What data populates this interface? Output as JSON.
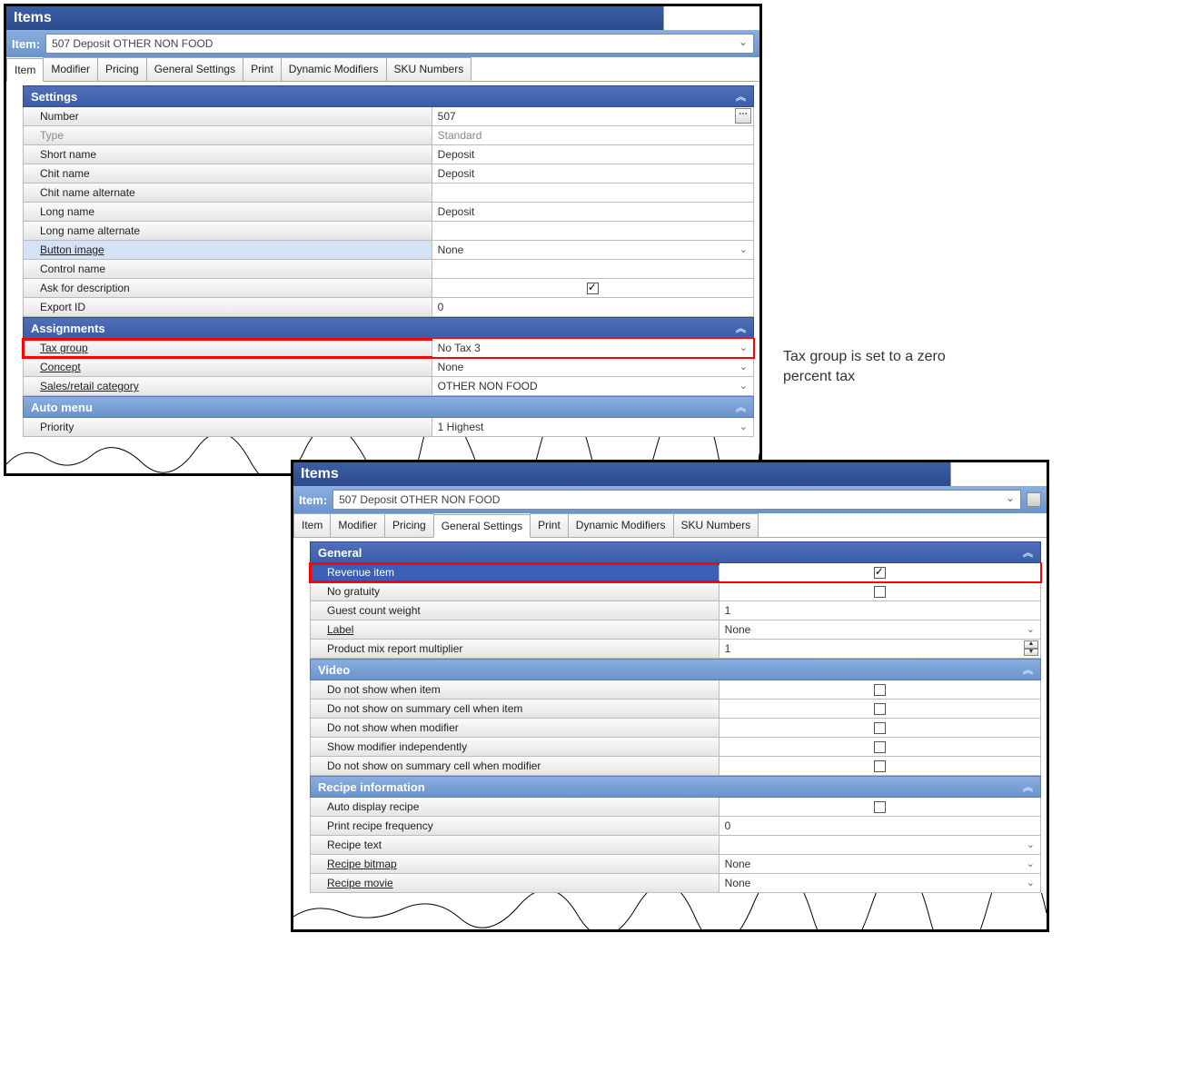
{
  "window_title": "Items",
  "item_label": "Item:",
  "item_value": "507 Deposit OTHER NON FOOD",
  "tabs": [
    "Item",
    "Modifier",
    "Pricing",
    "General Settings",
    "Print",
    "Dynamic Modifiers",
    "SKU Numbers"
  ],
  "shot1": {
    "active_tab": "Item",
    "sections": {
      "settings_header": "Settings",
      "assignments_header": "Assignments",
      "automenu_header": "Auto menu"
    },
    "rows": {
      "number_label": "Number",
      "number_value": "507",
      "type_label": "Type",
      "type_value": "Standard",
      "short_name_label": "Short name",
      "short_name_value": "Deposit",
      "chit_name_label": "Chit name",
      "chit_name_value": "Deposit",
      "chit_name_alt_label": "Chit name alternate",
      "chit_name_alt_value": "",
      "long_name_label": "Long name",
      "long_name_value": "Deposit",
      "long_name_alt_label": "Long name alternate",
      "long_name_alt_value": "",
      "button_image_label": "Button image",
      "button_image_value": "None",
      "control_name_label": "Control name",
      "control_name_value": "",
      "ask_desc_label": "Ask for description",
      "export_id_label": "Export ID",
      "export_id_value": "0",
      "tax_group_label": "Tax group",
      "tax_group_value": "No Tax 3",
      "concept_label": "Concept",
      "concept_value": "None",
      "category_label": "Sales/retail category",
      "category_value": "OTHER NON FOOD",
      "priority_label": "Priority",
      "priority_value": "1 Highest"
    }
  },
  "shot2": {
    "active_tab": "General Settings",
    "sections": {
      "general_header": "General",
      "video_header": "Video",
      "recipe_header": "Recipe information"
    },
    "rows": {
      "revenue_item_label": "Revenue item",
      "no_gratuity_label": "No gratuity",
      "guest_count_label": "Guest count weight",
      "guest_count_value": "1",
      "label_label": "Label",
      "label_value": "None",
      "pmix_label": "Product mix report multiplier",
      "pmix_value": "1",
      "dns_item_label": "Do not show when item",
      "dns_summary_item_label": "Do not show on summary cell when item",
      "dns_modifier_label": "Do not show when modifier",
      "show_mod_ind_label": "Show modifier independently",
      "dns_summary_mod_label": "Do not show on summary cell when modifier",
      "auto_display_recipe_label": "Auto display recipe",
      "print_recipe_freq_label": "Print recipe frequency",
      "print_recipe_freq_value": "0",
      "recipe_text_label": "Recipe text",
      "recipe_bitmap_label": "Recipe bitmap",
      "recipe_bitmap_value": "None",
      "recipe_movie_label": "Recipe movie",
      "recipe_movie_value": "None"
    }
  },
  "annotation": "Tax group is set to a zero percent tax"
}
